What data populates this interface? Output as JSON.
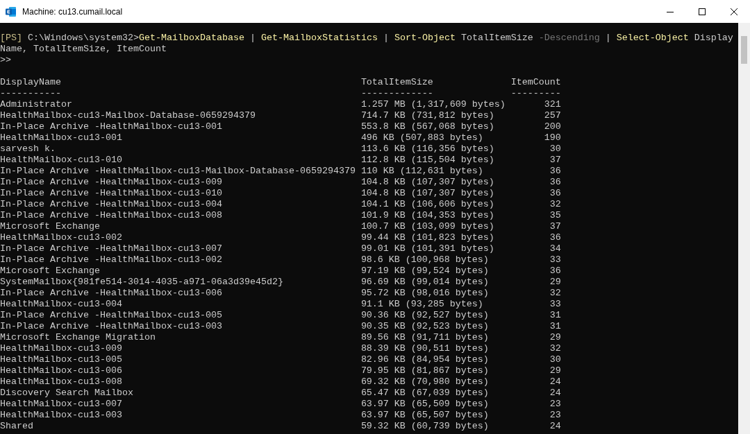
{
  "window": {
    "title": "Machine: cu13.cumail.local"
  },
  "command_lines": [
    {
      "tokens": [
        {
          "text": "[PS]",
          "kind": "tag"
        },
        {
          "text": " C:\\Windows\\system32>",
          "kind": "prompt"
        },
        {
          "text": "Get-MailboxDatabase",
          "kind": "command"
        },
        {
          "text": " |",
          "kind": "operator"
        },
        {
          "text": " Get-MailboxStatistics",
          "kind": "command"
        },
        {
          "text": " |",
          "kind": "operator"
        },
        {
          "text": " Sort-Object",
          "kind": "command"
        },
        {
          "text": " TotalItemSize",
          "kind": "argument"
        },
        {
          "text": " -Descending",
          "kind": "parameter"
        },
        {
          "text": " |",
          "kind": "operator"
        },
        {
          "text": " Select-Object",
          "kind": "command"
        },
        {
          "text": " Display",
          "kind": "argument"
        }
      ]
    },
    {
      "tokens": [
        {
          "text": "Name,",
          "kind": "argument"
        },
        {
          "text": " TotalItemSize,",
          "kind": "argument"
        },
        {
          "text": " ItemCount",
          "kind": "argument"
        }
      ]
    },
    {
      "tokens": [
        {
          "text": ">>",
          "kind": "prompt"
        }
      ]
    }
  ],
  "table": {
    "columns": [
      {
        "label": "DisplayName",
        "underline": "-----------"
      },
      {
        "label": "TotalItemSize",
        "underline": "-------------"
      },
      {
        "label": "ItemCount",
        "underline": "---------"
      }
    ],
    "rows": [
      {
        "name": "Administrator",
        "size": "1.257 MB (1,317,609 bytes)",
        "count": "321"
      },
      {
        "name": "HealthMailbox-cu13-Mailbox-Database-0659294379",
        "size": "714.7 KB (731,812 bytes)",
        "count": "257"
      },
      {
        "name": "In-Place Archive -HealthMailbox-cu13-001",
        "size": "553.8 KB (567,068 bytes)",
        "count": "200"
      },
      {
        "name": "HealthMailbox-cu13-001",
        "size": "496 KB (507,883 bytes)",
        "count": "190"
      },
      {
        "name": "sarvesh k.",
        "size": "113.6 KB (116,356 bytes)",
        "count": "30"
      },
      {
        "name": "HealthMailbox-cu13-010",
        "size": "112.8 KB (115,504 bytes)",
        "count": "37"
      },
      {
        "name": "In-Place Archive -HealthMailbox-cu13-Mailbox-Database-0659294379",
        "size": "110 KB (112,631 bytes)",
        "count": "36"
      },
      {
        "name": "In-Place Archive -HealthMailbox-cu13-009",
        "size": "104.8 KB (107,307 bytes)",
        "count": "36"
      },
      {
        "name": "In-Place Archive -HealthMailbox-cu13-010",
        "size": "104.8 KB (107,307 bytes)",
        "count": "36"
      },
      {
        "name": "In-Place Archive -HealthMailbox-cu13-004",
        "size": "104.1 KB (106,606 bytes)",
        "count": "32"
      },
      {
        "name": "In-Place Archive -HealthMailbox-cu13-008",
        "size": "101.9 KB (104,353 bytes)",
        "count": "35"
      },
      {
        "name": "Microsoft Exchange",
        "size": "100.7 KB (103,099 bytes)",
        "count": "37"
      },
      {
        "name": "HealthMailbox-cu13-002",
        "size": "99.44 KB (101,823 bytes)",
        "count": "36"
      },
      {
        "name": "In-Place Archive -HealthMailbox-cu13-007",
        "size": "99.01 KB (101,391 bytes)",
        "count": "34"
      },
      {
        "name": "In-Place Archive -HealthMailbox-cu13-002",
        "size": "98.6 KB (100,968 bytes)",
        "count": "33"
      },
      {
        "name": "Microsoft Exchange",
        "size": "97.19 KB (99,524 bytes)",
        "count": "36"
      },
      {
        "name": "SystemMailbox{981fe514-3014-4035-a971-06a3d39e45d2}",
        "size": "96.69 KB (99,014 bytes)",
        "count": "29"
      },
      {
        "name": "In-Place Archive -HealthMailbox-cu13-006",
        "size": "95.72 KB (98,016 bytes)",
        "count": "32"
      },
      {
        "name": "HealthMailbox-cu13-004",
        "size": "91.1 KB (93,285 bytes)",
        "count": "33"
      },
      {
        "name": "In-Place Archive -HealthMailbox-cu13-005",
        "size": "90.36 KB (92,527 bytes)",
        "count": "31"
      },
      {
        "name": "In-Place Archive -HealthMailbox-cu13-003",
        "size": "90.35 KB (92,523 bytes)",
        "count": "31"
      },
      {
        "name": "Microsoft Exchange Migration",
        "size": "89.56 KB (91,711 bytes)",
        "count": "29"
      },
      {
        "name": "HealthMailbox-cu13-009",
        "size": "88.39 KB (90,511 bytes)",
        "count": "32"
      },
      {
        "name": "HealthMailbox-cu13-005",
        "size": "82.96 KB (84,954 bytes)",
        "count": "30"
      },
      {
        "name": "HealthMailbox-cu13-006",
        "size": "79.95 KB (81,867 bytes)",
        "count": "29"
      },
      {
        "name": "HealthMailbox-cu13-008",
        "size": "69.32 KB (70,980 bytes)",
        "count": "24"
      },
      {
        "name": "Discovery Search Mailbox",
        "size": "65.47 KB (67,039 bytes)",
        "count": "24"
      },
      {
        "name": "HealthMailbox-cu13-007",
        "size": "63.97 KB (65,509 bytes)",
        "count": "23"
      },
      {
        "name": "HealthMailbox-cu13-003",
        "size": "63.97 KB (65,507 bytes)",
        "count": "23"
      },
      {
        "name": "Shared",
        "size": "59.32 KB (60,739 bytes)",
        "count": "24"
      }
    ]
  }
}
